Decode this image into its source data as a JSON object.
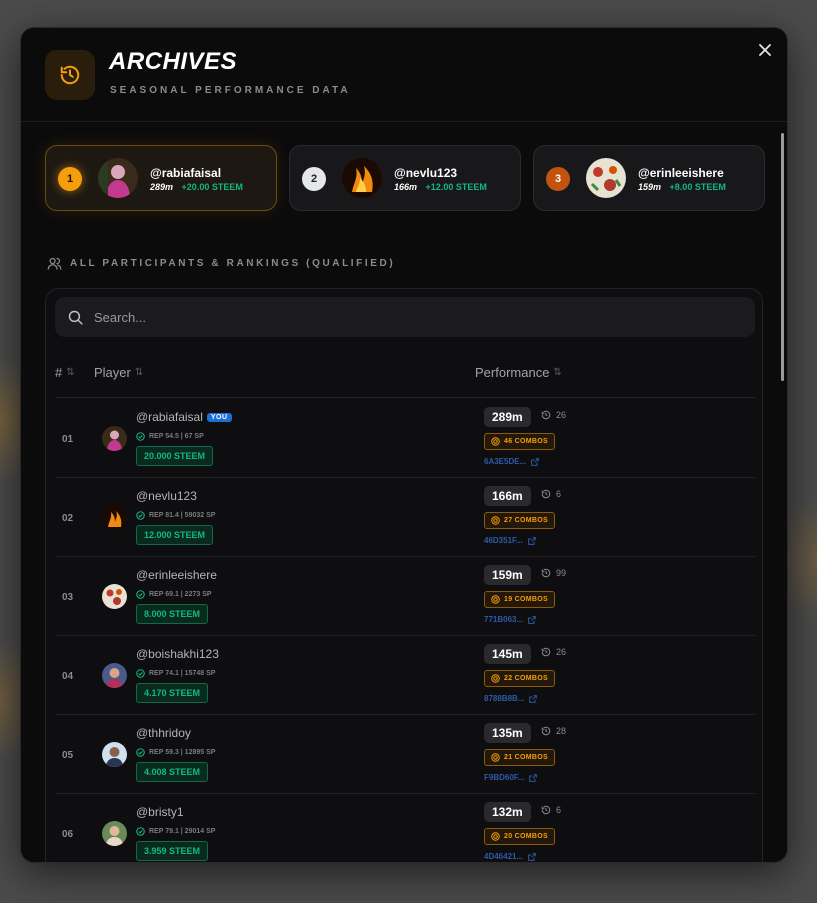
{
  "header": {
    "title": "ARCHIVES",
    "subtitle": "SEASONAL PERFORMANCE DATA",
    "icon": "history-icon",
    "accent": "#f59e0b"
  },
  "podium": [
    {
      "rank": "1",
      "username": "@rabiafaisal",
      "distance": "289m",
      "reward": "+20.00 STEEM"
    },
    {
      "rank": "2",
      "username": "@nevlu123",
      "distance": "166m",
      "reward": "+12.00 STEEM"
    },
    {
      "rank": "3",
      "username": "@erinleeishere",
      "distance": "159m",
      "reward": "+8.00 STEEM"
    }
  ],
  "section_label": "ALL PARTICIPANTS & RANKINGS (QUALIFIED)",
  "search": {
    "placeholder": "Search..."
  },
  "table": {
    "columns": {
      "rank": "#",
      "player": "Player",
      "performance": "Performance"
    },
    "rows": [
      {
        "rank": "01",
        "username": "@rabiafaisal",
        "you_badge": "YOU",
        "rep": "REP 54.5 | 67 SP",
        "steem": "20.000 STEEM",
        "distance": "289m",
        "jumps": "26",
        "combos": "46 COMBOS",
        "hash": "6A3E5DE..."
      },
      {
        "rank": "02",
        "username": "@nevlu123",
        "rep": "REP 81.4 | 59032 SP",
        "steem": "12.000 STEEM",
        "distance": "166m",
        "jumps": "6",
        "combos": "27 COMBOS",
        "hash": "46D351F..."
      },
      {
        "rank": "03",
        "username": "@erinleeishere",
        "rep": "REP 69.1 | 2273 SP",
        "steem": "8.000 STEEM",
        "distance": "159m",
        "jumps": "99",
        "combos": "19 COMBOS",
        "hash": "771B063..."
      },
      {
        "rank": "04",
        "username": "@boishakhi123",
        "rep": "REP 74.1 | 15748 SP",
        "steem": "4.170 STEEM",
        "distance": "145m",
        "jumps": "26",
        "combos": "22 COMBOS",
        "hash": "8788B8B..."
      },
      {
        "rank": "05",
        "username": "@thhridoy",
        "rep": "REP 59.3 | 12895 SP",
        "steem": "4.008 STEEM",
        "distance": "135m",
        "jumps": "28",
        "combos": "21 COMBOS",
        "hash": "F9BD60F..."
      },
      {
        "rank": "06",
        "username": "@bristy1",
        "rep": "REP 79.1 | 29014 SP",
        "steem": "3.959 STEEM",
        "distance": "132m",
        "jumps": "6",
        "combos": "20 COMBOS",
        "hash": "4D46421..."
      }
    ]
  }
}
